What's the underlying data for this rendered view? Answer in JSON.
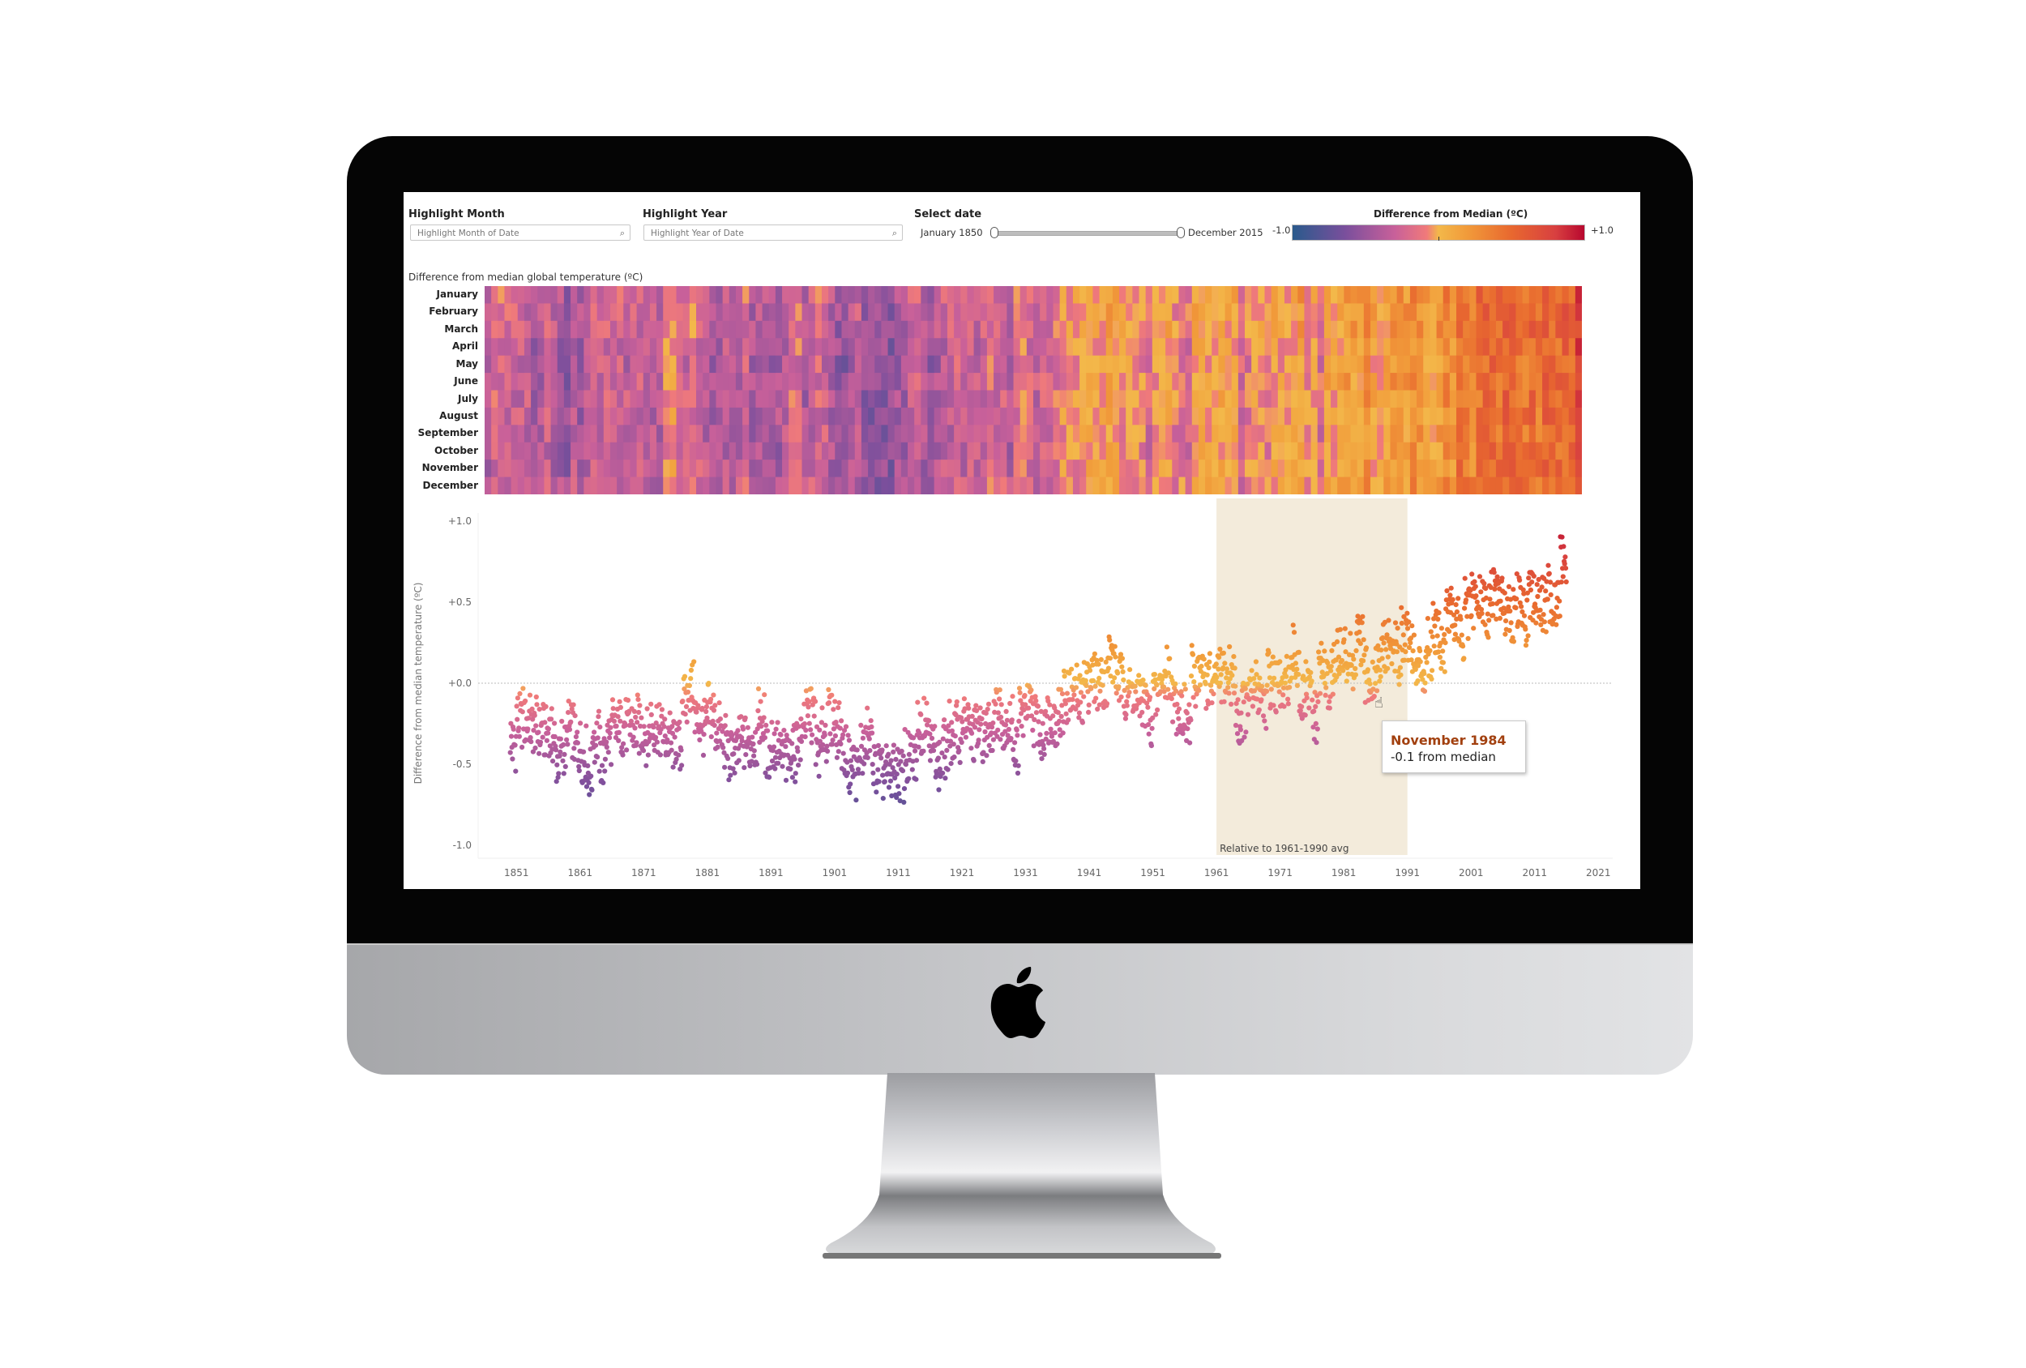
{
  "filters": {
    "highlight_month": {
      "label": "Highlight Month",
      "placeholder": "Highlight Month of Date"
    },
    "highlight_year": {
      "label": "Highlight Year",
      "placeholder": "Highlight Year of Date"
    },
    "select_date": {
      "label": "Select date",
      "start": "January 1850",
      "end": "December 2015",
      "start_fraction": 0.0,
      "end_fraction": 1.0
    }
  },
  "legend": {
    "title": "Difference from Median (ºC)",
    "min_label": "-1.0",
    "max_label": "+1.0",
    "stops": [
      "#2a5a8c",
      "#7a4f9c",
      "#c8609a",
      "#f07a7a",
      "#f3b84a",
      "#f19a3a",
      "#e8682f",
      "#d84040",
      "#b8082f"
    ]
  },
  "tooltip": {
    "title": "November 1984",
    "body": "-0.1 from median",
    "month": "November",
    "year": 1984,
    "value": -0.1
  },
  "chart_data": [
    {
      "type": "heatmap",
      "title": "Difference from median global temperature (ºC)",
      "rows": [
        "January",
        "February",
        "March",
        "April",
        "May",
        "June",
        "July",
        "August",
        "September",
        "October",
        "November",
        "December"
      ],
      "x_range": [
        1850,
        2015
      ],
      "color_range": [
        -1.0,
        1.0
      ],
      "value_source": "annual_anomaly + month_offset"
    },
    {
      "type": "scatter",
      "title": "",
      "xlabel": "",
      "ylabel": "Difference from median temperature (ºC)",
      "ylim": [
        -1.0,
        1.0
      ],
      "xlim": [
        1846,
        2023
      ],
      "yticks": [
        "+1.0",
        "+0.5",
        "+0.0",
        "-0.5",
        "-1.0"
      ],
      "ytick_values": [
        1.0,
        0.5,
        0.0,
        -0.5,
        -1.0
      ],
      "xticks": [
        "1851",
        "1861",
        "1871",
        "1881",
        "1891",
        "1901",
        "1911",
        "1921",
        "1931",
        "1941",
        "1951",
        "1961",
        "1971",
        "1981",
        "1991",
        "2001",
        "2011",
        "2021"
      ],
      "reference_line": 0.0,
      "band": {
        "from": 1961,
        "to": 1991,
        "label": "Relative to 1961-1990 avg",
        "color": "#f3ebdb"
      },
      "years": [
        1850,
        1851,
        1852,
        1853,
        1854,
        1855,
        1856,
        1857,
        1858,
        1859,
        1860,
        1861,
        1862,
        1863,
        1864,
        1865,
        1866,
        1867,
        1868,
        1869,
        1870,
        1871,
        1872,
        1873,
        1874,
        1875,
        1876,
        1877,
        1878,
        1879,
        1880,
        1881,
        1882,
        1883,
        1884,
        1885,
        1886,
        1887,
        1888,
        1889,
        1890,
        1891,
        1892,
        1893,
        1894,
        1895,
        1896,
        1897,
        1898,
        1899,
        1900,
        1901,
        1902,
        1903,
        1904,
        1905,
        1906,
        1907,
        1908,
        1909,
        1910,
        1911,
        1912,
        1913,
        1914,
        1915,
        1916,
        1917,
        1918,
        1919,
        1920,
        1921,
        1922,
        1923,
        1924,
        1925,
        1926,
        1927,
        1928,
        1929,
        1930,
        1931,
        1932,
        1933,
        1934,
        1935,
        1936,
        1937,
        1938,
        1939,
        1940,
        1941,
        1942,
        1943,
        1944,
        1945,
        1946,
        1947,
        1948,
        1949,
        1950,
        1951,
        1952,
        1953,
        1954,
        1955,
        1956,
        1957,
        1958,
        1959,
        1960,
        1961,
        1962,
        1963,
        1964,
        1965,
        1966,
        1967,
        1968,
        1969,
        1970,
        1971,
        1972,
        1973,
        1974,
        1975,
        1976,
        1977,
        1978,
        1979,
        1980,
        1981,
        1982,
        1983,
        1984,
        1985,
        1986,
        1987,
        1988,
        1989,
        1990,
        1991,
        1992,
        1993,
        1994,
        1995,
        1996,
        1997,
        1998,
        1999,
        2000,
        2001,
        2002,
        2003,
        2004,
        2005,
        2006,
        2007,
        2008,
        2009,
        2010,
        2011,
        2012,
        2013,
        2014,
        2015
      ],
      "annual_anomaly": [
        -0.37,
        -0.23,
        -0.23,
        -0.27,
        -0.29,
        -0.3,
        -0.32,
        -0.47,
        -0.39,
        -0.28,
        -0.39,
        -0.43,
        -0.54,
        -0.33,
        -0.47,
        -0.33,
        -0.29,
        -0.27,
        -0.27,
        -0.28,
        -0.28,
        -0.32,
        -0.25,
        -0.29,
        -0.34,
        -0.37,
        -0.38,
        -0.11,
        -0.02,
        -0.23,
        -0.27,
        -0.18,
        -0.27,
        -0.35,
        -0.44,
        -0.43,
        -0.36,
        -0.38,
        -0.35,
        -0.23,
        -0.43,
        -0.38,
        -0.44,
        -0.47,
        -0.42,
        -0.35,
        -0.21,
        -0.19,
        -0.42,
        -0.3,
        -0.22,
        -0.27,
        -0.41,
        -0.5,
        -0.54,
        -0.41,
        -0.35,
        -0.52,
        -0.56,
        -0.57,
        -0.54,
        -0.57,
        -0.47,
        -0.46,
        -0.26,
        -0.21,
        -0.4,
        -0.5,
        -0.41,
        -0.32,
        -0.3,
        -0.23,
        -0.32,
        -0.3,
        -0.31,
        -0.26,
        -0.17,
        -0.24,
        -0.25,
        -0.38,
        -0.19,
        -0.15,
        -0.21,
        -0.33,
        -0.2,
        -0.22,
        -0.18,
        -0.08,
        -0.07,
        -0.1,
        0.0,
        0.04,
        0.01,
        0.02,
        0.15,
        0.03,
        -0.03,
        -0.04,
        -0.1,
        -0.1,
        -0.21,
        -0.09,
        0.01,
        0.06,
        -0.13,
        -0.15,
        -0.24,
        0.03,
        0.06,
        0.02,
        -0.03,
        0.04,
        0.03,
        0.04,
        -0.22,
        -0.15,
        -0.07,
        -0.03,
        -0.1,
        0.02,
        -0.02,
        -0.07,
        0.03,
        0.14,
        -0.11,
        -0.05,
        -0.21,
        0.09,
        -0.01,
        0.09,
        0.18,
        0.15,
        0.09,
        0.26,
        0.06,
        0.04,
        0.1,
        0.23,
        0.23,
        0.18,
        0.31,
        0.26,
        0.08,
        0.11,
        0.21,
        0.35,
        0.24,
        0.46,
        0.39,
        0.29,
        0.44,
        0.49,
        0.51,
        0.45,
        0.55,
        0.51,
        0.49,
        0.43,
        0.5,
        0.41,
        0.54,
        0.48,
        0.5,
        0.53,
        0.5,
        0.76
      ],
      "month_offsets": [
        0.05,
        0.04,
        0.02,
        -0.01,
        -0.02,
        -0.01,
        0.0,
        -0.01,
        -0.02,
        -0.02,
        -0.01,
        0.01
      ],
      "highlight_point": {
        "label": "November 1984",
        "value": -0.1
      }
    }
  ]
}
